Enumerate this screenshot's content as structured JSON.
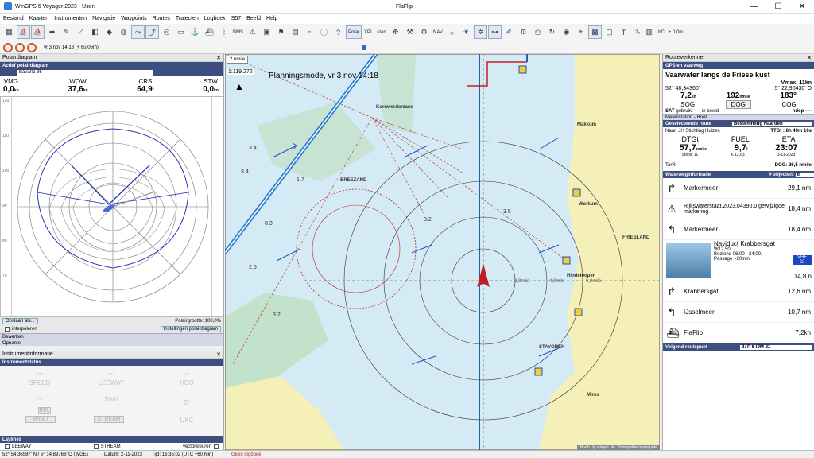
{
  "window": {
    "title": "WinGPS 6 Voyager 2023 - User:",
    "doc": "FlaFlip",
    "min": "—",
    "max": "☐",
    "close": "✕"
  },
  "menu": [
    "Bestand",
    "Kaarten",
    "Instrumenten",
    "Navigatie",
    "Waypoints",
    "Routes",
    "Trajecten",
    "Logboek",
    "S57",
    "Beeld",
    "Help"
  ],
  "toolbar": {
    "bms": "BMS",
    "polar": "Polar",
    "xpl": "XPL",
    "start": "start",
    "nav": "NAV",
    "f12": "12₈",
    "bc": "bC",
    "offset": "+ 0,0m"
  },
  "datebar": {
    "text": "vr 3 nov 14:18  (+ 6u 06m)"
  },
  "polar": {
    "title": "Polairdiagram",
    "section": "Actief polairdiagram",
    "boat": "Bavaria 36",
    "labels": {
      "vmg": "VMG",
      "wow": "WOW",
      "crs": "CRS",
      "stw": "STW"
    },
    "values": {
      "vmg": "0,0",
      "wow": "37,6",
      "crs": "64,9",
      "stw": "0,0"
    },
    "units": {
      "vmg": "kn",
      "wow": "kn",
      "crs": "°",
      "stw": "kn"
    },
    "scale": [
      "120",
      "110",
      "100",
      "90",
      "80",
      "70"
    ],
    "save": "Opslaan als...",
    "size": "Polairgrootte: 100,0%",
    "interpolate": "interpoleren",
    "settings": "Instellingen polairdiagram",
    "bewerken": "Bewerken",
    "opname": "Opname"
  },
  "instrument": {
    "title": "Instrumentinformatie",
    "section": "Instrumentstatus",
    "speed": "SPEED",
    "leeway": "LEEWAY",
    "hdg": "HDG",
    "depth": "DEPTH",
    "ukc": "UKC",
    "wind": "WIND",
    "stream": "STREAM",
    "rel": "REL",
    "val": "---",
    "from": "from",
    "deg": "0°"
  },
  "laylines": {
    "title": "Laylines",
    "leeway": "LEEWAY",
    "stream": "STREAM",
    "vector": "vectorkleuren"
  },
  "chart": {
    "mode": "Planningsmode, vr 3 nov 14:18",
    "scale": "1:119.272",
    "nm": "2 nmile",
    "places": [
      "BREEZAND",
      "FRIESLAND",
      "Makkum",
      "Workum",
      "Hindeloopen",
      "STAVOREN",
      "Kornwerderzand",
      "Mirns"
    ],
    "rings": [
      "2,0mile",
      "4,0mile",
      "6,0mile"
    ],
    "footer": "North Up  volgen uit  ·  Voorspelde routepunte"
  },
  "router": {
    "title": "Routeverkenner",
    "gps": "GPS en vaarweg",
    "waterway": "Vaarwater langs de Friese kust",
    "vmax": "Vmax: 11kn",
    "lat": "52° 48,34360'",
    "lon": "5° 22,90430' O",
    "sog": "7,2",
    "sog_u": "kn",
    "dist": "192",
    "dist_u": "nmile",
    "cog": "183°",
    "sog_l": "SOG",
    "dog_l": "DOG",
    "cog_l": "COG",
    "sat": "SAT",
    "sat_extra": "gebruikt ---- in beeld",
    "hdop": "hdop ----",
    "meten": "Metenstation - Boot",
    "route_l": "Geselecteerde route",
    "route_v": "Bestemming Naarden",
    "naar": "Naar: JH Stichting Huizen",
    "ttg": "TTGt : 8h 49m 10s",
    "dtgt_l": "DTGt",
    "fuel_l": "FUEL",
    "eta_l": "ETA",
    "dtgt": "57,7",
    "dtgt_u": "nmile",
    "fuel": "9,7",
    "fuel_u": "l",
    "eta": "23:07",
    "stops": "Stops: 1L",
    "cost": "€ 12,63",
    "date": "3-11-2023",
    "torr": "TorR: ----",
    "dog2": "DOG: 26,5 nmile",
    "wvi": "Waterweginformatie",
    "objects": "# objecten:",
    "obj_n": "6",
    "items": [
      {
        "name": "Markermeer",
        "dist": "29,1 nm",
        "icon": "↱"
      },
      {
        "name": "Rijkswaterstaat.2023.04390.0 gewijzigde markering",
        "dist": "18,4 nm",
        "icon": "⚠"
      },
      {
        "name": "Markermeer",
        "dist": "18,4 nm",
        "icon": "↰"
      }
    ],
    "bridge": {
      "name": "Naviduct Krabbersgat",
      "w": "W12,50",
      "hours": "Bediend 06:00 - 24:00.",
      "pass": "Passage ~20min.",
      "dist": "14,8 n",
      "vhf": "VHF",
      "ch": "22"
    },
    "items2": [
      {
        "name": "Krabbersgat",
        "dist": "12,6 nm",
        "icon": "↱"
      },
      {
        "name": "IJsselmeer",
        "dist": "10,7 nm",
        "icon": "↰"
      },
      {
        "name": "FlaFlip",
        "dist": "7,2kn",
        "icon": "⛴"
      }
    ],
    "next_l": "Volgend routepunt",
    "next_v": "2: P 6-IJM 21"
  },
  "status": {
    "pos": "52° 54,36587' N / 5° 14,89766' O (WGE)",
    "datum": "Datum: 2-11-2023",
    "tijd": "Tijd: 16:35:02 (UTC +60 min)",
    "log": "Geen logboek"
  }
}
